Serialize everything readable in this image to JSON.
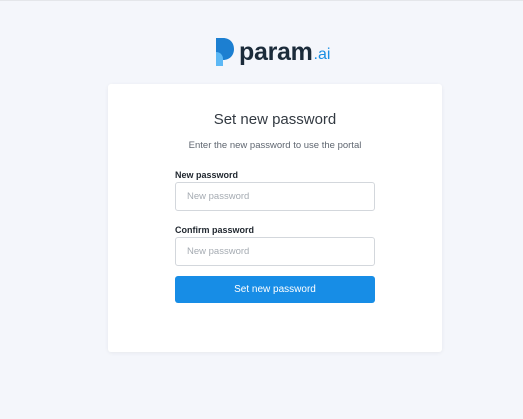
{
  "brand": {
    "name": "param",
    "suffix": ".ai",
    "colors": {
      "mark_dark": "#1c7fd1",
      "mark_light": "#5cb8f5",
      "wordmark": "#1b2b3a",
      "suffix": "#1a8fe3"
    }
  },
  "form": {
    "title": "Set new password",
    "subtitle": "Enter the new password to use the portal",
    "new_password": {
      "label": "New password",
      "placeholder": "New password",
      "value": ""
    },
    "confirm_password": {
      "label": "Confirm password",
      "placeholder": "New password",
      "value": ""
    },
    "submit_label": "Set new password",
    "accent_color": "#178de6"
  }
}
